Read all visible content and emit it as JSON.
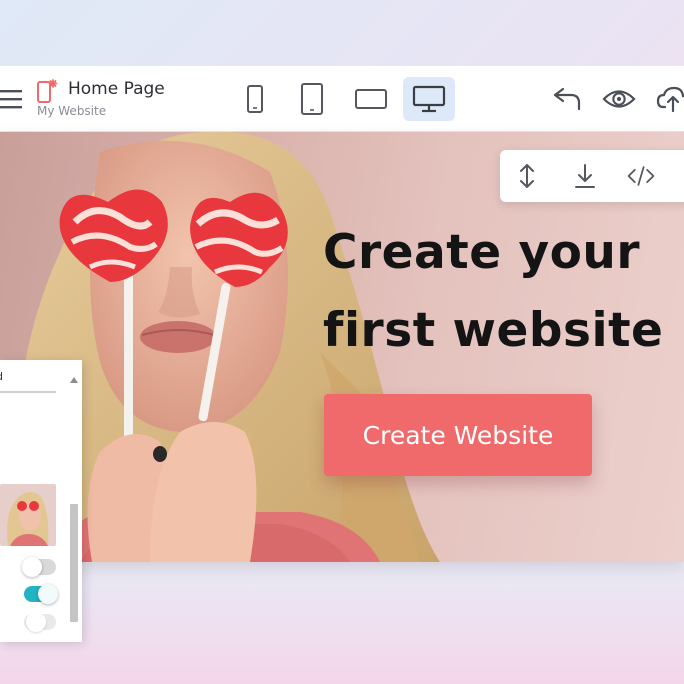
{
  "toolbar": {
    "page_title": "Home Page",
    "site_name": "My Website",
    "icons": {
      "menu": "menu-icon",
      "page": "page-icon",
      "devices": [
        "mobile-icon",
        "tablet-icon",
        "tablet-landscape-icon",
        "desktop-icon"
      ],
      "actions": [
        "undo-icon",
        "preview-eye-icon",
        "publish-cloud-upload-icon"
      ]
    },
    "active_device": "desktop"
  },
  "canvas": {
    "headline": [
      "Create your",
      "first website"
    ],
    "cta_label": "Create Website",
    "floating_tools": [
      "resize-vertical-icon",
      "download-icon",
      "code-icon"
    ]
  },
  "side_panel": {
    "label": "d",
    "toggles": [
      {
        "state": "off"
      },
      {
        "state": "on"
      },
      {
        "state": "off"
      }
    ]
  },
  "colors": {
    "accent_cta": "#f0696b",
    "active_device_bg": "#dde9f8",
    "toggle_on": "#22b3c4",
    "page_icon": "#f0696b"
  }
}
